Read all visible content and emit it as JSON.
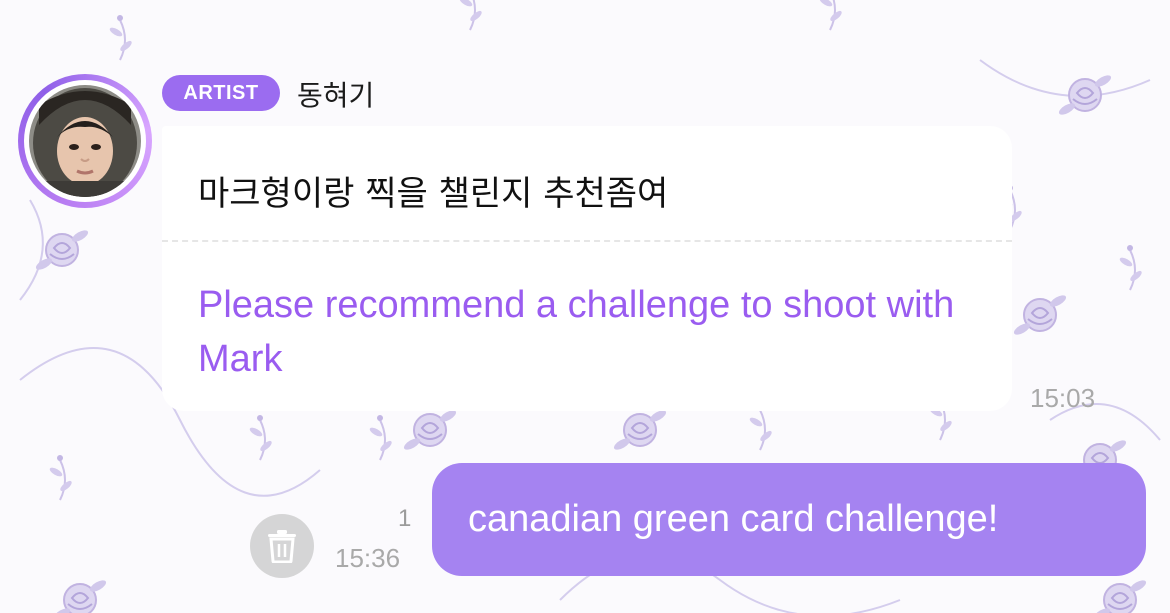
{
  "theme": {
    "accent": "#9b6cf0",
    "translation_color": "#9a5cf0",
    "outgoing_bubble": "#a583f1",
    "wallpaper_motif": "#b7a8dc"
  },
  "artist_message": {
    "badge": "ARTIST",
    "sender_name": "동혀기",
    "original_text": "마크형이랑 찍을 챌린지 추천좀여",
    "translation_text": "Please recommend a challenge to shoot with Mark",
    "time": "15:03",
    "avatar_icon": "profile-photo"
  },
  "my_message": {
    "text": "canadian green card challenge!",
    "read_count": "1",
    "time": "15:36",
    "delete_icon": "trash-icon"
  }
}
